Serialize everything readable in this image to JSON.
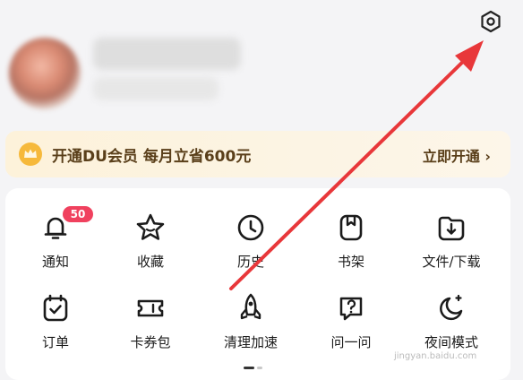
{
  "vip": {
    "text": "开通DU会员 每月立省600元",
    "action": "立即开通 ›"
  },
  "menu": {
    "row1": [
      {
        "label": "通知",
        "badge": "50",
        "icon": "bell-icon"
      },
      {
        "label": "收藏",
        "icon": "star-icon"
      },
      {
        "label": "历史",
        "icon": "clock-icon"
      },
      {
        "label": "书架",
        "icon": "bookshelf-icon"
      },
      {
        "label": "文件/下载",
        "icon": "download-folder-icon"
      }
    ],
    "row2": [
      {
        "label": "订单",
        "icon": "calendar-check-icon"
      },
      {
        "label": "卡券包",
        "icon": "ticket-icon"
      },
      {
        "label": "清理加速",
        "icon": "rocket-icon"
      },
      {
        "label": "问一问",
        "icon": "question-icon"
      },
      {
        "label": "夜间模式",
        "icon": "moon-icon"
      }
    ]
  },
  "watermark": "jingyan.baidu.com",
  "colors": {
    "background": "#f4f4f6",
    "vip_banner": "#fdf2da",
    "vip_text": "#5a3f1a",
    "badge": "#f0415e",
    "annotation_arrow": "#e8373a"
  }
}
